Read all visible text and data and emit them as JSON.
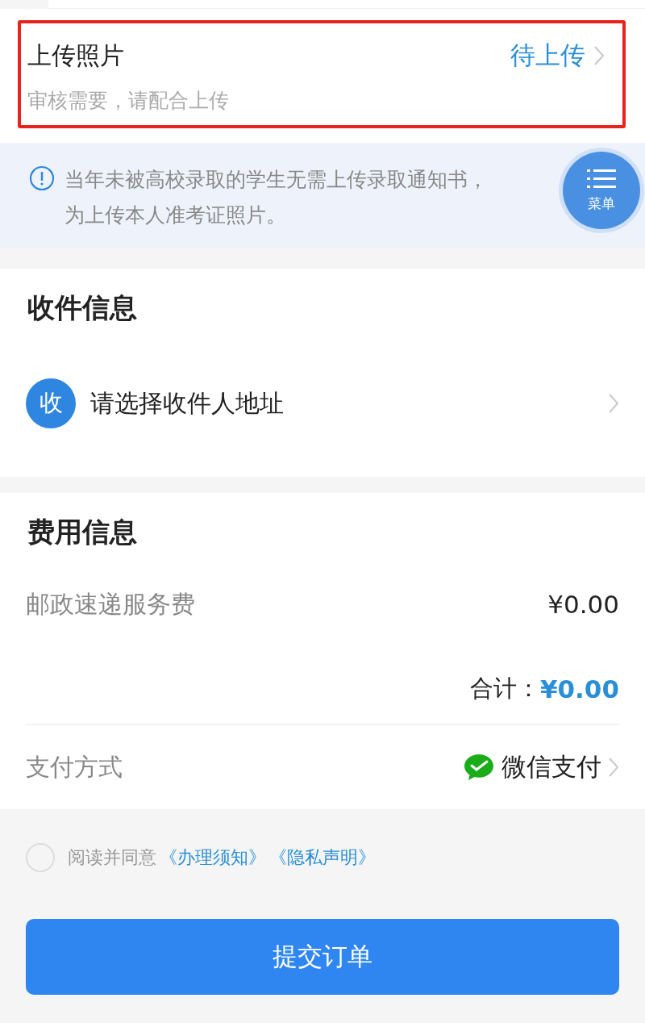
{
  "upload": {
    "title": "上传照片",
    "hint": "审核需要，请配合上传",
    "status": "待上传",
    "highlighted": true
  },
  "notice": {
    "text": "当年未被高校录取的学生无需上传录取通知书，为上传本人准考证照片。"
  },
  "menu_button": {
    "label": "菜单"
  },
  "recipient": {
    "title": "收件信息",
    "avatar": "收",
    "placeholder": "请选择收件人地址"
  },
  "fees": {
    "title": "费用信息",
    "items": [
      {
        "label": "邮政速递服务费",
        "value": "¥0.00"
      }
    ],
    "total_label": "合计：",
    "total_value": "¥0.00",
    "payment_label": "支付方式",
    "payment_method": "微信支付"
  },
  "agreement": {
    "checked": false,
    "text": "阅读并同意",
    "links": [
      "《办理须知》",
      "《隐私声明》"
    ]
  },
  "submit": {
    "label": "提交订单"
  }
}
